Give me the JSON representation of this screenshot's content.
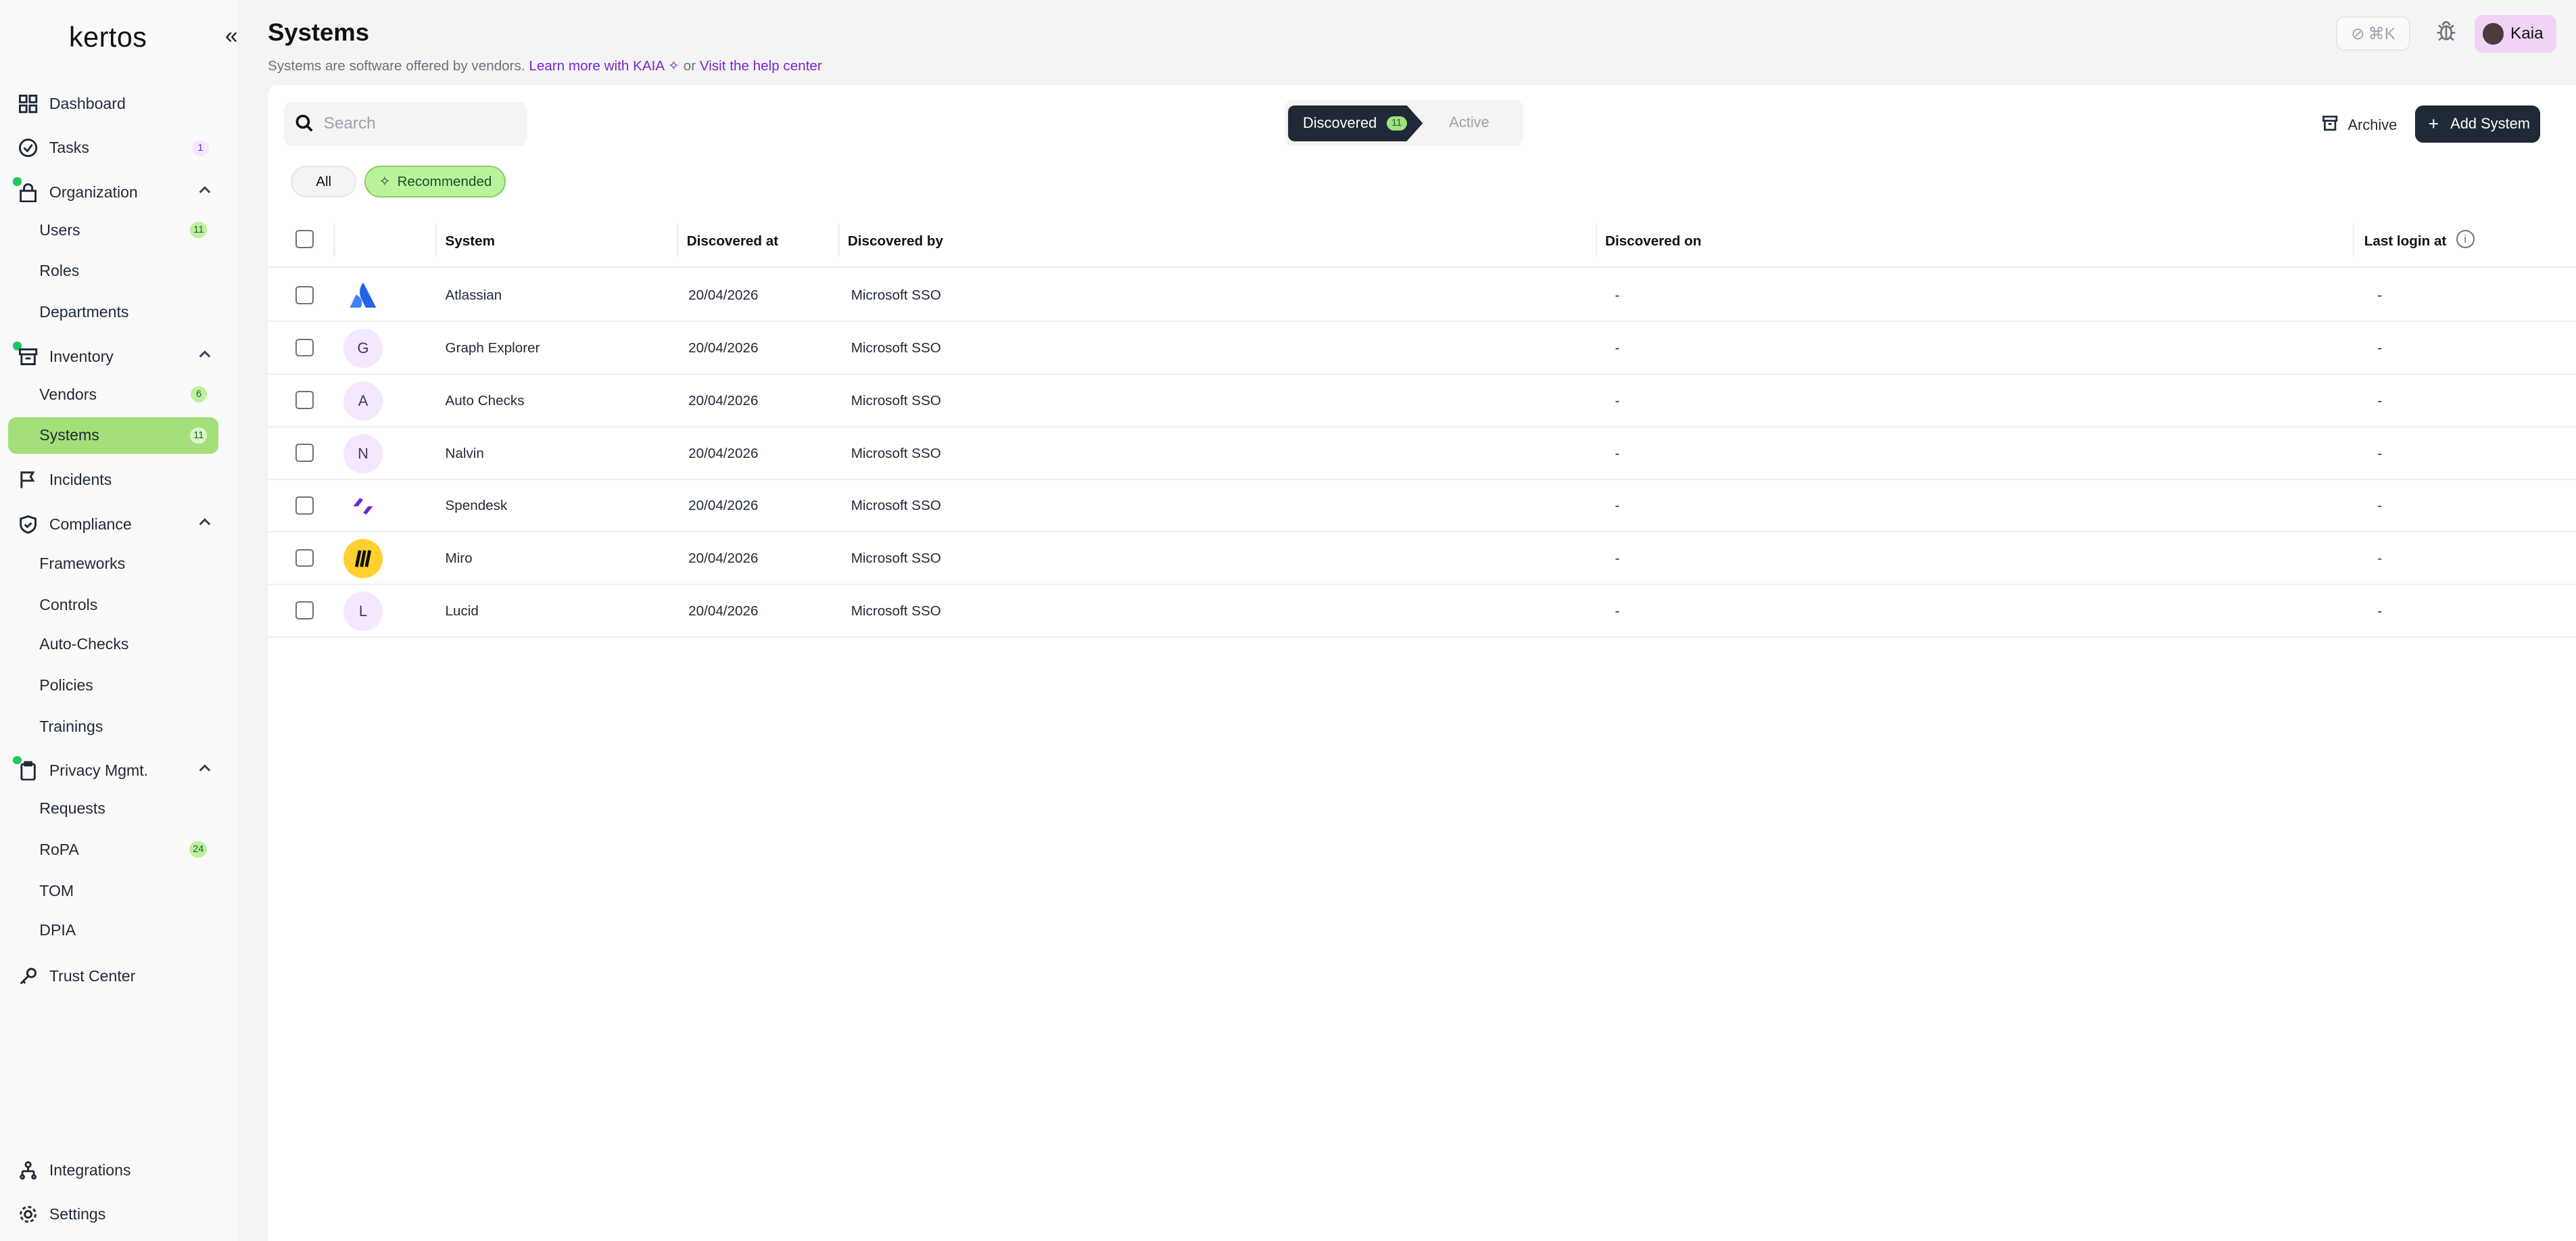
{
  "sidebar": {
    "logo": "kertos",
    "items": {
      "dashboard": "Dashboard",
      "tasks": "Tasks",
      "tasks_badge": "1",
      "organization": "Organization",
      "users": "Users",
      "users_badge": "11",
      "roles": "Roles",
      "departments": "Departments",
      "inventory": "Inventory",
      "vendors": "Vendors",
      "vendors_badge": "6",
      "systems": "Systems",
      "systems_badge": "11",
      "incidents": "Incidents",
      "compliance": "Compliance",
      "frameworks": "Frameworks",
      "controls": "Controls",
      "autochecks": "Auto-Checks",
      "policies": "Policies",
      "trainings": "Trainings",
      "privacy": "Privacy Mgmt.",
      "requests": "Requests",
      "ropa": "RoPA",
      "ropa_badge": "24",
      "tom": "TOM",
      "dpia": "DPIA",
      "trust": "Trust Center",
      "integrations": "Integrations",
      "settings": "Settings"
    }
  },
  "header": {
    "title": "Systems",
    "subtitle_prefix": "Systems are software offered by vendors.",
    "link_kaia": "Learn more with KAIA",
    "or": "or",
    "link_help": "Visit the help center",
    "shortcut": "⌘K",
    "user": "Kaia"
  },
  "toolbar": {
    "search_placeholder": "Search",
    "tab_discovered": "Discovered",
    "tab_discovered_count": "11",
    "tab_active": "Active",
    "archive": "Archive",
    "add_system": "Add System",
    "filter_all": "All",
    "filter_recommended": "Recommended"
  },
  "table": {
    "columns": {
      "system": "System",
      "discovered_at": "Discovered at",
      "discovered_by": "Discovered by",
      "discovered_on": "Discovered on",
      "last_login": "Last login at"
    },
    "rows": [
      {
        "name": "Atlassian",
        "icon": "atlassian-logo",
        "date": "20/04/2026",
        "by": "Microsoft SSO",
        "on": "-",
        "last": "-"
      },
      {
        "name": "Graph Explorer",
        "icon": "G",
        "date": "20/04/2026",
        "by": "Microsoft SSO",
        "on": "-",
        "last": "-"
      },
      {
        "name": "Auto Checks",
        "icon": "A",
        "date": "20/04/2026",
        "by": "Microsoft SSO",
        "on": "-",
        "last": "-"
      },
      {
        "name": "Nalvin",
        "icon": "N",
        "date": "20/04/2026",
        "by": "Microsoft SSO",
        "on": "-",
        "last": "-"
      },
      {
        "name": "Spendesk",
        "icon": "spendesk-logo",
        "date": "20/04/2026",
        "by": "Microsoft SSO",
        "on": "-",
        "last": "-"
      },
      {
        "name": "Miro",
        "icon": "miro-logo",
        "date": "20/04/2026",
        "by": "Microsoft SSO",
        "on": "-",
        "last": "-"
      },
      {
        "name": "Lucid",
        "icon": "L",
        "date": "20/04/2026",
        "by": "Microsoft SSO",
        "on": "-",
        "last": "-"
      }
    ]
  },
  "colors": {
    "accent_green": "#a3e07a",
    "dark": "#1f2937",
    "link_purple": "#7e22ce"
  }
}
